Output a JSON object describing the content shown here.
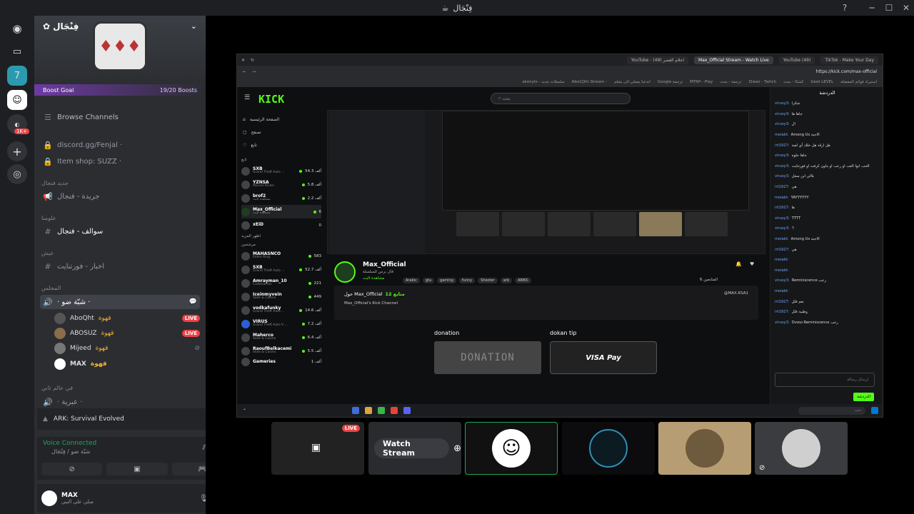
{
  "window": {
    "title": "فِنْجَال"
  },
  "server": {
    "name": "فِنْجَال",
    "boost_label": "Boost Goal",
    "boost_count": "19/20 Boosts",
    "badge_1k": "1K+"
  },
  "channels": {
    "browse": "Browse Channels",
    "items": [
      {
        "label": "discord.gg/Fenjal ·"
      },
      {
        "label": "Item shop: SUZZ ·"
      }
    ],
    "cat1": "جديد فنجال",
    "cat1_item": "جريدة - فنجال",
    "cat2": "علومنا",
    "cat2_item": "سوالف - فنجال",
    "cat3": "عيش",
    "cat3_item": "اخبار - فورتنايت",
    "cat4": "المجلس",
    "voice_channel": "· شبّة ضو ·",
    "voice_users": [
      {
        "name": "AboQht",
        "tag": "قهوة",
        "live": "LIVE"
      },
      {
        "name": "ABOSUZ",
        "tag": "قهوة",
        "live": "LIVE"
      },
      {
        "name": "Mijeed",
        "tag": "قهوة",
        "live": ""
      },
      {
        "name": "MAX",
        "tag": "قهوة",
        "live": ""
      }
    ],
    "cat5": "في عالم ثاني",
    "cat5_item": "· عبرية ·"
  },
  "activity": {
    "game": "ARK: Survival Evolved"
  },
  "voice": {
    "status": "Voice Connected",
    "channel": "شبّة ضو / فِنْجَال"
  },
  "user": {
    "name": "MAX",
    "status": "صلي على النبي"
  },
  "kick": {
    "tabs": [
      "YouTube - احلام العصر (49)",
      "Max_Official Stream - Watch Live",
      "YouTube (49)",
      "TikTok - Make Your Day"
    ],
    "url": "https://kick.com/max-official",
    "bookmarks": [
      "استيراد قوائم المفضلة",
      "Geet LEVEL",
      "كشكا - بحث",
      "f2waz - Twitch",
      "ترجمة - بحث",
      "MTRP - Play",
      "Google ترجمة",
      "اندعيا يعملي الى يتعلم",
      "Abo1Qht Stream -",
      "akonyts - سلسلات جديد"
    ],
    "logo": "KICK",
    "search": "بحث",
    "nav": [
      "الصفحة الرئيسية",
      "تصفح",
      "تابع"
    ],
    "follow_header": "تابع",
    "following": [
      {
        "name": "SXB",
        "sub": "Grand Theft Auto ...",
        "viewers": "54.3 ألف"
      },
      {
        "name": "YZNSA",
        "sub": "Marvel Rivals",
        "viewers": "5.8 ألف"
      },
      {
        "name": "brof2",
        "sub": "مشاهدة البث",
        "viewers": "2.2 ألف"
      },
      {
        "name": "Max_Official",
        "sub": "مشاهدة البث",
        "viewers": "6"
      },
      {
        "name": "xEiD",
        "sub": "",
        "viewers": "0"
      }
    ],
    "more_following": "اظهر المزيد",
    "rec_header": "مرشحين",
    "recommended": [
      {
        "name": "MAHASNCO",
        "sub": "Elden Ring",
        "viewers": "583"
      },
      {
        "name": "SXB",
        "sub": "Grand Theft Auto ...",
        "viewers": "52.7 ألف"
      },
      {
        "name": "Amrayman_10",
        "sub": "Codenames",
        "viewers": "221"
      },
      {
        "name": "Iceinmyvein",
        "sub": "Slots & Casino",
        "viewers": "449"
      },
      {
        "name": "vodkafunky",
        "sub": "Grand Theft Auto ...",
        "viewers": "14.6 ألف"
      },
      {
        "name": "VIRUS",
        "sub": "Grand Theft Auto V ...",
        "viewers": "7.2 ألف"
      },
      {
        "name": "Maherco",
        "sub": "Slots & Casino",
        "viewers": "6.4 ألف"
      },
      {
        "name": "RaoufBelkacemi",
        "sub": "Slots & Casino",
        "viewers": "5.5 ألف"
      },
      {
        "name": "Gameries",
        "sub": "",
        "viewers": "1 ألف"
      }
    ],
    "streamer": "Max_Official",
    "streamer_game": "قال برس للسلسلة",
    "streamer_sub": "مشاهدة البث",
    "tags": [
      "Arabic",
      "gta",
      "gaming",
      "funny",
      "Shooter",
      "arb",
      "ARBIC"
    ],
    "followers": "المتابعين 6",
    "about_title": "حول Max_Official",
    "about_count": "12 متابع",
    "about_text": "Max_Official's Kick Channel",
    "about_social": "@MAX.KSA1",
    "panel1": "donation",
    "panel2": "dokan tip",
    "donation_img": "DONATION",
    "visa_img": "VISA Pay",
    "chat_title": "الدردشة",
    "chat": [
      {
        "u": "virusy3:",
        "t": "شكرا"
      },
      {
        "u": "virusy3:",
        "t": "جاها ها"
      },
      {
        "u": "virusy3:",
        "t": "ال"
      },
      {
        "u": "moiakt:",
        "t": "Among Us الاجبة"
      },
      {
        "u": "irt1927:",
        "t": "هل ارقة هل خلك أي لعبة"
      },
      {
        "u": "virusy3:",
        "t": "جاها حلوه"
      },
      {
        "u": "virusy3:",
        "t": "الحب ابوا العب او رعب او ماون كرفت او فورتنايت"
      },
      {
        "u": "virusy3:",
        "t": "بلالي ابن سعل"
      },
      {
        "u": "irt1927:",
        "t": "هي"
      },
      {
        "u": "moiakt:",
        "t": "YAYYYYYY"
      },
      {
        "u": "irt1927:",
        "t": "ها"
      },
      {
        "u": "virusy3:",
        "t": "TTTT"
      },
      {
        "u": "virusy3:",
        "t": "'l"
      },
      {
        "u": "moiakt:",
        "t": "Among Us الاجبة"
      },
      {
        "u": "irt1927:",
        "t": "هي"
      },
      {
        "u": "moiakt:",
        "t": ""
      },
      {
        "u": "moiakt:",
        "t": ""
      },
      {
        "u": "virusy3:",
        "t": "Reminiscence رعب"
      },
      {
        "u": "moiakt:",
        "t": ""
      },
      {
        "u": "irt1927:",
        "t": "نعم فلل"
      },
      {
        "u": "irt1927:",
        "t": "وطيبة فلل"
      },
      {
        "u": "virusy3:",
        "t": "Dvour.Reminiscence رعب"
      }
    ],
    "chat_placeholder": "إرسال رسالة",
    "chat_send": "الدردشة",
    "task_search": "بحث"
  },
  "tiles": {
    "live": "LIVE",
    "watch": "Watch Stream"
  }
}
